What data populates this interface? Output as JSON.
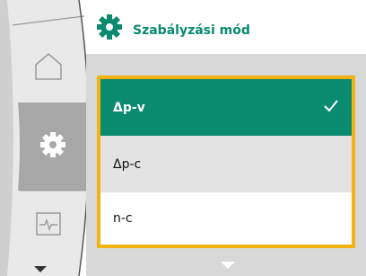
{
  "header": {
    "title": "Szabályzási mód",
    "icon": "gear-icon"
  },
  "sidebar": {
    "items": [
      {
        "icon": "home-icon",
        "active": false
      },
      {
        "icon": "gear-icon",
        "active": true
      },
      {
        "icon": "pulse-icon",
        "active": false
      }
    ],
    "scroll_icon": "chevron-down-icon"
  },
  "options": [
    {
      "label": "Δp-v",
      "selected": true
    },
    {
      "label": "Δp-c",
      "selected": false
    },
    {
      "label": "n-c",
      "selected": false
    }
  ],
  "colors": {
    "accent": "#0a8a6e",
    "focus_frame": "#f2b213"
  }
}
